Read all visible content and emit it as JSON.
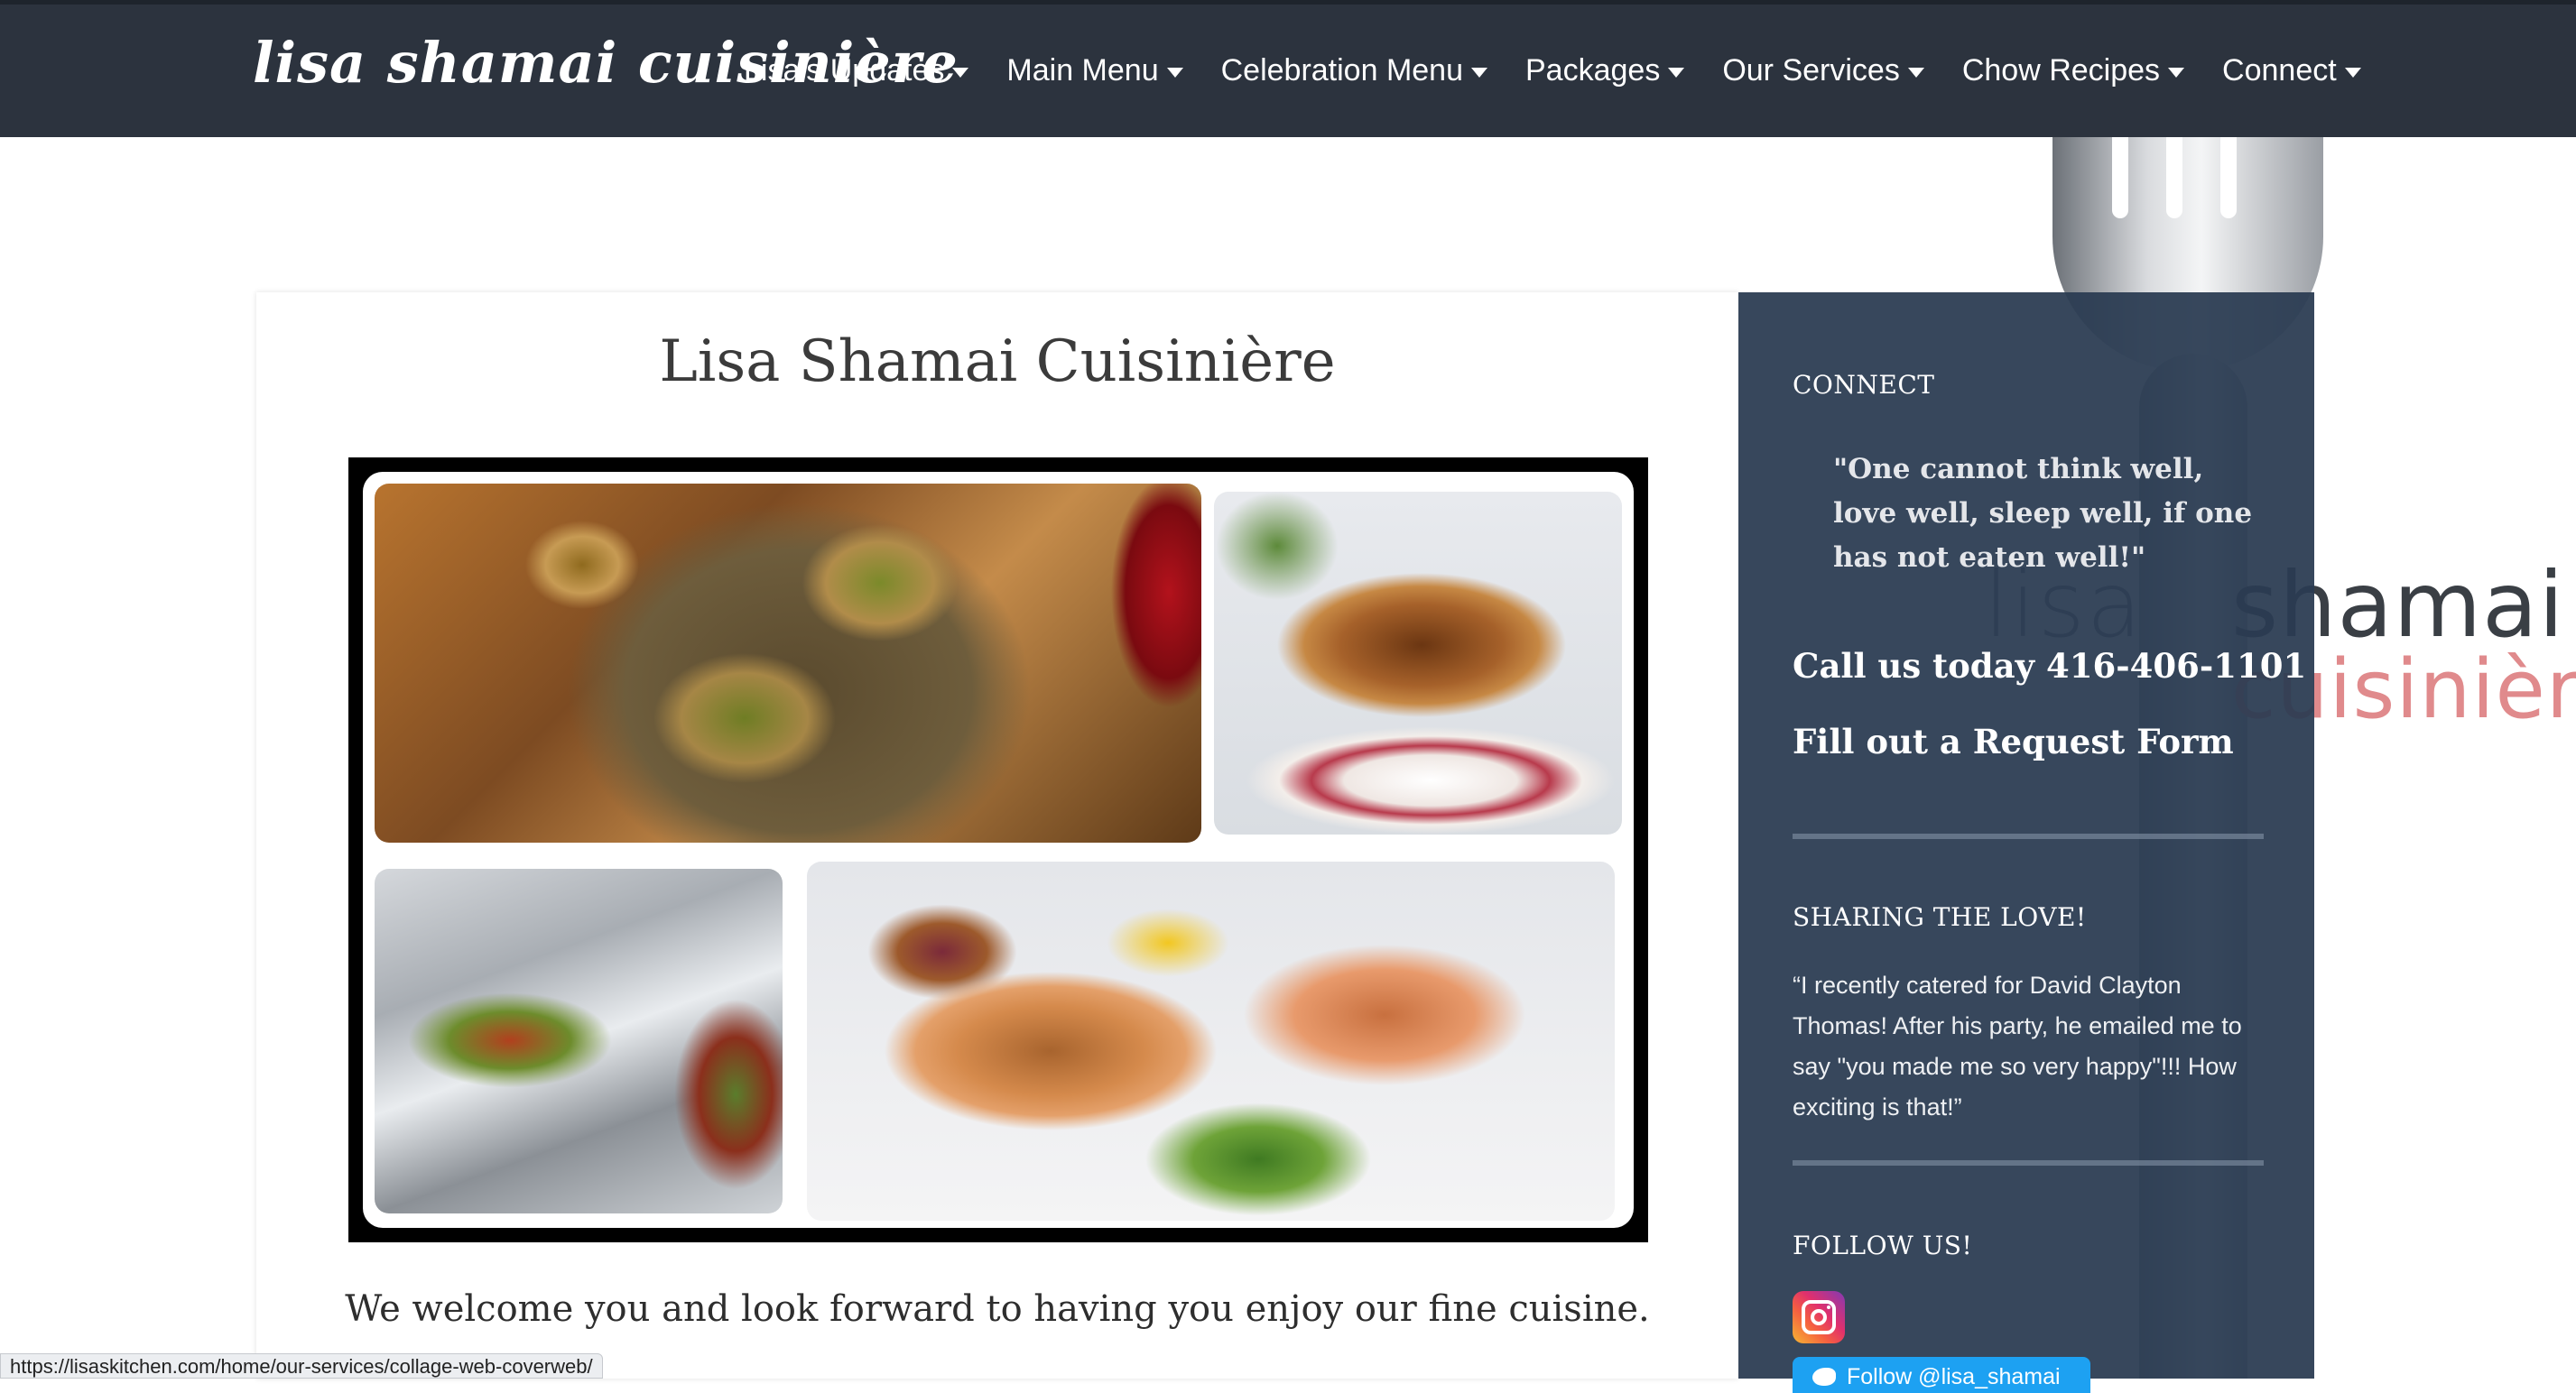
{
  "header": {
    "brand": "lisa shamai cuisinière",
    "nav": [
      {
        "label": "Lisa’s Updates"
      },
      {
        "label": "Main Menu"
      },
      {
        "label": "Celebration Menu"
      },
      {
        "label": "Packages"
      },
      {
        "label": "Our Services"
      },
      {
        "label": "Chow Recipes"
      },
      {
        "label": "Connect"
      }
    ]
  },
  "background_logo": {
    "word1": "lisa",
    "word2": "shamai",
    "word3": "cuisinière"
  },
  "main": {
    "title": "Lisa Shamai Cuisinière",
    "welcome": "We welcome you and look forward to having you enjoy our fine cuisine."
  },
  "sidebar": {
    "connect_title": "CONNECT",
    "quote": "\"One cannot think well, love well, sleep well, if one has not eaten well!\"",
    "call": "Call us today 416-406-1101",
    "request": "Fill out a Request Form",
    "sharing_title": "SHARING THE LOVE!",
    "testimonial": "“I recently catered for David Clayton Thomas! After his party, he emailed me to say \"you made me so very happy\"!!! How exciting is that!”",
    "follow_title": "FOLLOW US!",
    "twitter_label": "Follow @lisa_shamai"
  },
  "status_bar": {
    "url": "https://lisaskitchen.com/home/our-services/collage-web-coverweb/"
  },
  "colors": {
    "navbar": "#2c333e",
    "sidebar": "#2b3c52",
    "twitter": "#1da1f2"
  }
}
